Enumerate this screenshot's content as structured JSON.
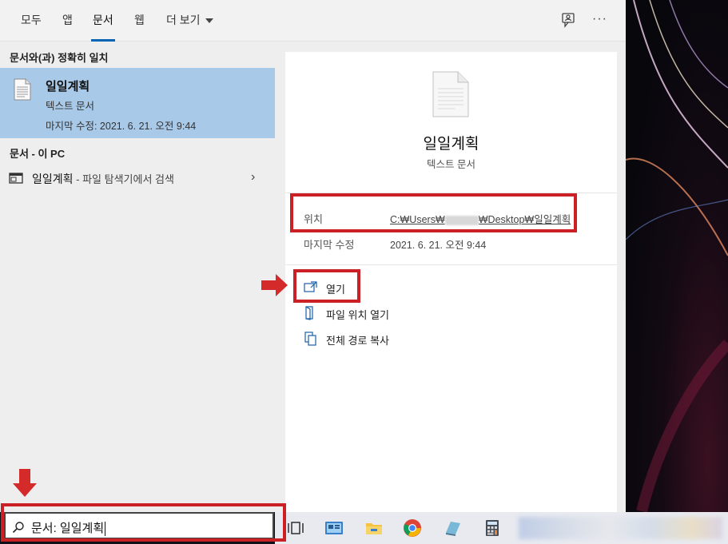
{
  "tabs": [
    {
      "label": "모두"
    },
    {
      "label": "앱"
    },
    {
      "label": "문서",
      "active": true
    },
    {
      "label": "웹"
    },
    {
      "label": "더 보기"
    }
  ],
  "header_icons": {
    "feedback": "feedback-icon",
    "more": "···"
  },
  "results": {
    "best_match_heading": "문서와(과) 정확히 일치",
    "best_match": {
      "title": "일일계획",
      "type": "텍스트 문서",
      "modified": "마지막 수정: 2021. 6. 21. 오전 9:44"
    },
    "pc_heading": "문서 - 이 PC",
    "pc_item": {
      "name": "일일계획",
      "subtitle": " - 파일 탐색기에서 검색",
      "chevron": "›"
    }
  },
  "preview": {
    "title": "일일계획",
    "type": "텍스트 문서",
    "location_label": "위치",
    "location_prefix": "C:₩Users₩",
    "location_suffix": "₩Desktop₩일일계획",
    "modified_label": "마지막 수정",
    "modified_value": "2021. 6. 21. 오전 9:44",
    "actions": [
      {
        "label": "열기",
        "icon": "open-icon"
      },
      {
        "label": "파일 위치 열기",
        "icon": "folder-location-icon"
      },
      {
        "label": "전체 경로 복사",
        "icon": "copy-icon"
      }
    ]
  },
  "search": {
    "text": "문서: 일일계획"
  },
  "colors": {
    "accent": "#0a64b4",
    "highlight": "#cc2027",
    "selected": "#a9c9e8"
  },
  "taskbar_icons": [
    "task-view-icon",
    "app-icon",
    "file-explorer-icon",
    "chrome-icon",
    "app-icon",
    "calculator-icon"
  ]
}
